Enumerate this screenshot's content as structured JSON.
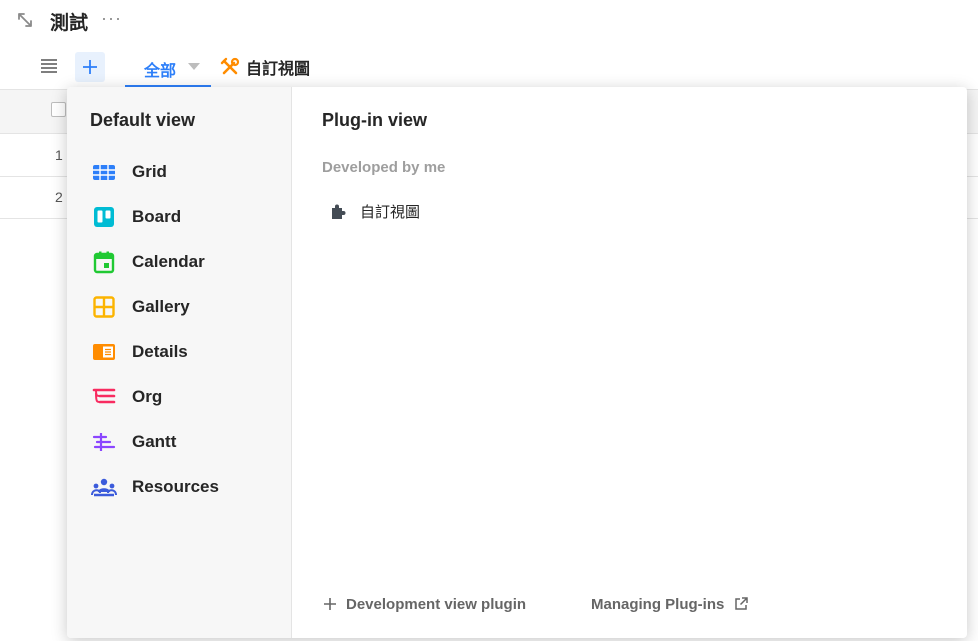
{
  "header": {
    "title": "測試",
    "more_label": "···"
  },
  "toolbar": {
    "tabs": [
      {
        "label": "全部"
      },
      {
        "label": "自訂視圖"
      }
    ]
  },
  "grid": {
    "rows": [
      {
        "number": "1"
      },
      {
        "number": "2"
      }
    ]
  },
  "popup": {
    "default_view": {
      "title": "Default view",
      "items": [
        {
          "label": "Grid",
          "icon": "grid-icon",
          "color": "#2d7ff9"
        },
        {
          "label": "Board",
          "icon": "board-icon",
          "color": "#00bcd4"
        },
        {
          "label": "Calendar",
          "icon": "calendar-icon",
          "color": "#20c933"
        },
        {
          "label": "Gallery",
          "icon": "gallery-icon",
          "color": "#fcb400"
        },
        {
          "label": "Details",
          "icon": "details-icon",
          "color": "#ff8c00"
        },
        {
          "label": "Org",
          "icon": "org-icon",
          "color": "#f82b60"
        },
        {
          "label": "Gantt",
          "icon": "gantt-icon",
          "color": "#8b46ff"
        },
        {
          "label": "Resources",
          "icon": "resources-icon",
          "color": "#3b5bdb"
        }
      ]
    },
    "plugin_view": {
      "title": "Plug-in view",
      "section": "Developed by me",
      "items": [
        {
          "label": "自訂視圖",
          "icon": "puzzle-icon"
        }
      ]
    },
    "footer": {
      "develop_label": "Development view plugin",
      "manage_label": "Managing Plug-ins"
    }
  }
}
